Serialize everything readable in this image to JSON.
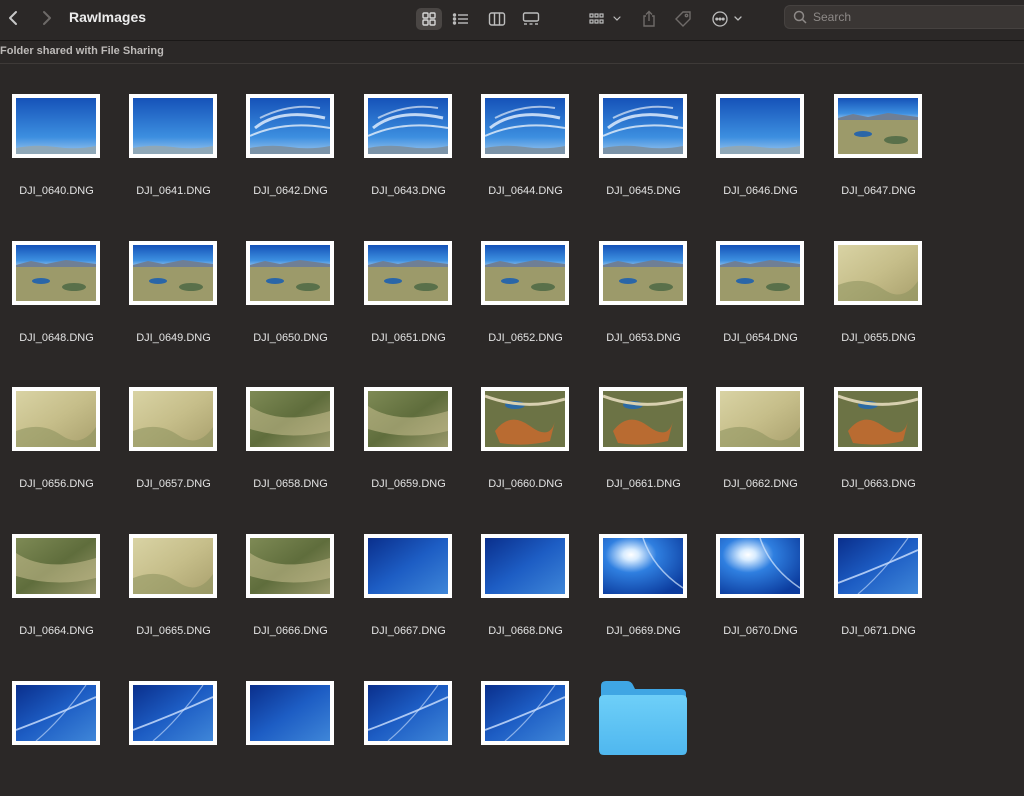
{
  "window": {
    "title": "RawImages",
    "path_note": "Folder shared with File Sharing"
  },
  "toolbar": {
    "back_icon": "chevron-left-icon",
    "forward_icon": "chevron-right-icon",
    "view_modes": [
      "icon-view",
      "list-view",
      "column-view",
      "gallery-view"
    ],
    "active_view": "icon-view",
    "search_placeholder": "Search"
  },
  "files": [
    {
      "name": "DJI_0640.DNG",
      "kind": "sky"
    },
    {
      "name": "DJI_0641.DNG",
      "kind": "sky"
    },
    {
      "name": "DJI_0642.DNG",
      "kind": "cloud"
    },
    {
      "name": "DJI_0643.DNG",
      "kind": "cloud"
    },
    {
      "name": "DJI_0644.DNG",
      "kind": "cloud"
    },
    {
      "name": "DJI_0645.DNG",
      "kind": "cloud"
    },
    {
      "name": "DJI_0646.DNG",
      "kind": "sky"
    },
    {
      "name": "DJI_0647.DNG",
      "kind": "horizon"
    },
    {
      "name": "DJI_0648.DNG",
      "kind": "horizon"
    },
    {
      "name": "DJI_0649.DNG",
      "kind": "horizon"
    },
    {
      "name": "DJI_0650.DNG",
      "kind": "horizon"
    },
    {
      "name": "DJI_0651.DNG",
      "kind": "horizon"
    },
    {
      "name": "DJI_0652.DNG",
      "kind": "horizon"
    },
    {
      "name": "DJI_0653.DNG",
      "kind": "horizon"
    },
    {
      "name": "DJI_0654.DNG",
      "kind": "horizon"
    },
    {
      "name": "DJI_0655.DNG",
      "kind": "land"
    },
    {
      "name": "DJI_0656.DNG",
      "kind": "land"
    },
    {
      "name": "DJI_0657.DNG",
      "kind": "land"
    },
    {
      "name": "DJI_0658.DNG",
      "kind": "green"
    },
    {
      "name": "DJI_0659.DNG",
      "kind": "green"
    },
    {
      "name": "DJI_0660.DNG",
      "kind": "orange"
    },
    {
      "name": "DJI_0661.DNG",
      "kind": "orange"
    },
    {
      "name": "DJI_0662.DNG",
      "kind": "land"
    },
    {
      "name": "DJI_0663.DNG",
      "kind": "orange"
    },
    {
      "name": "DJI_0664.DNG",
      "kind": "green"
    },
    {
      "name": "DJI_0665.DNG",
      "kind": "land"
    },
    {
      "name": "DJI_0666.DNG",
      "kind": "green"
    },
    {
      "name": "DJI_0667.DNG",
      "kind": "deepblue"
    },
    {
      "name": "DJI_0668.DNG",
      "kind": "deepblue"
    },
    {
      "name": "DJI_0669.DNG",
      "kind": "sun"
    },
    {
      "name": "DJI_0670.DNG",
      "kind": "sun"
    },
    {
      "name": "DJI_0671.DNG",
      "kind": "contrail"
    },
    {
      "name": "",
      "kind": "contrail"
    },
    {
      "name": "",
      "kind": "contrail"
    },
    {
      "name": "",
      "kind": "deepblue"
    },
    {
      "name": "",
      "kind": "contrail"
    },
    {
      "name": "",
      "kind": "contrail"
    },
    {
      "name": "",
      "kind": "folder"
    }
  ],
  "colors": {
    "background": "#2b2827",
    "folder": "#5cc3f5"
  }
}
